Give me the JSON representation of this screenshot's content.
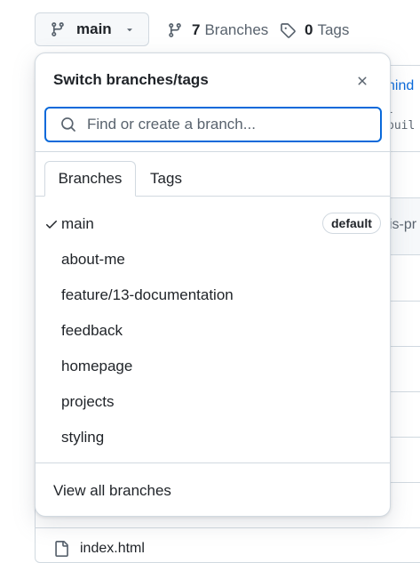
{
  "branch_button": {
    "label": "main",
    "icon": "git-branch-icon",
    "caret_icon": "triangle-down-icon"
  },
  "header_links": {
    "branches": {
      "count": "7",
      "label": "Branches",
      "icon": "git-branch-icon"
    },
    "tags": {
      "count": "0",
      "label": "Tags",
      "icon": "tag-icon"
    }
  },
  "popover": {
    "title": "Switch branches/tags",
    "close_icon": "x-icon",
    "search": {
      "placeholder": "Find or create a branch...",
      "value": "",
      "icon": "search-icon",
      "focus_color": "#0969da"
    },
    "tabs": [
      {
        "label": "Branches",
        "active": true
      },
      {
        "label": "Tags",
        "active": false
      }
    ],
    "branches": [
      {
        "name": "main",
        "selected": true,
        "badge": "default"
      },
      {
        "name": "about-me"
      },
      {
        "name": "feature/13-documentation"
      },
      {
        "name": "feedback"
      },
      {
        "name": "homepage"
      },
      {
        "name": "projects"
      },
      {
        "name": "styling"
      }
    ],
    "footer_link": "View all branches"
  },
  "background": {
    "link_text": "hind",
    "code_text": "-buil",
    "text_fragment": "is-pr",
    "file_name": "index.html"
  }
}
